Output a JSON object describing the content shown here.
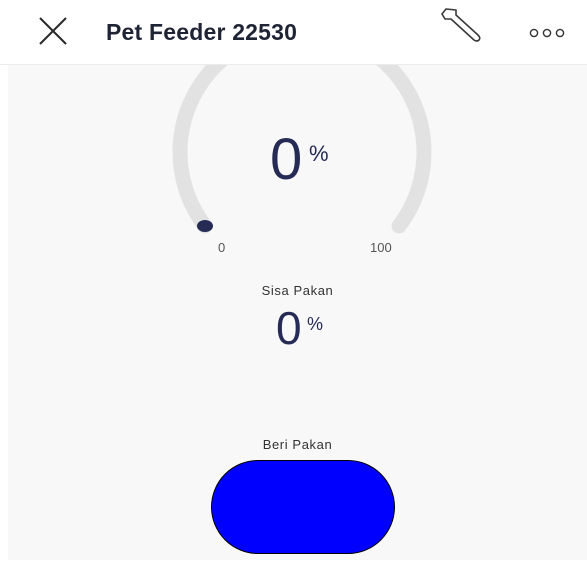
{
  "header": {
    "title": "Pet Feeder 22530",
    "close_icon": "close-icon",
    "settings_icon": "wrench-icon",
    "more_icon": "more-options-icon"
  },
  "gauge": {
    "value": 0,
    "value_text": "0",
    "unit": "%",
    "min_label": "0",
    "max_label": "100",
    "track_color": "#e2e2e2",
    "indicator_color": "#252b55"
  },
  "sisa_pakan": {
    "label": "Sisa Pakan",
    "value": "0",
    "unit": "%"
  },
  "beri_pakan": {
    "label": "Beri Pakan",
    "button_color": "#0000ff"
  }
}
